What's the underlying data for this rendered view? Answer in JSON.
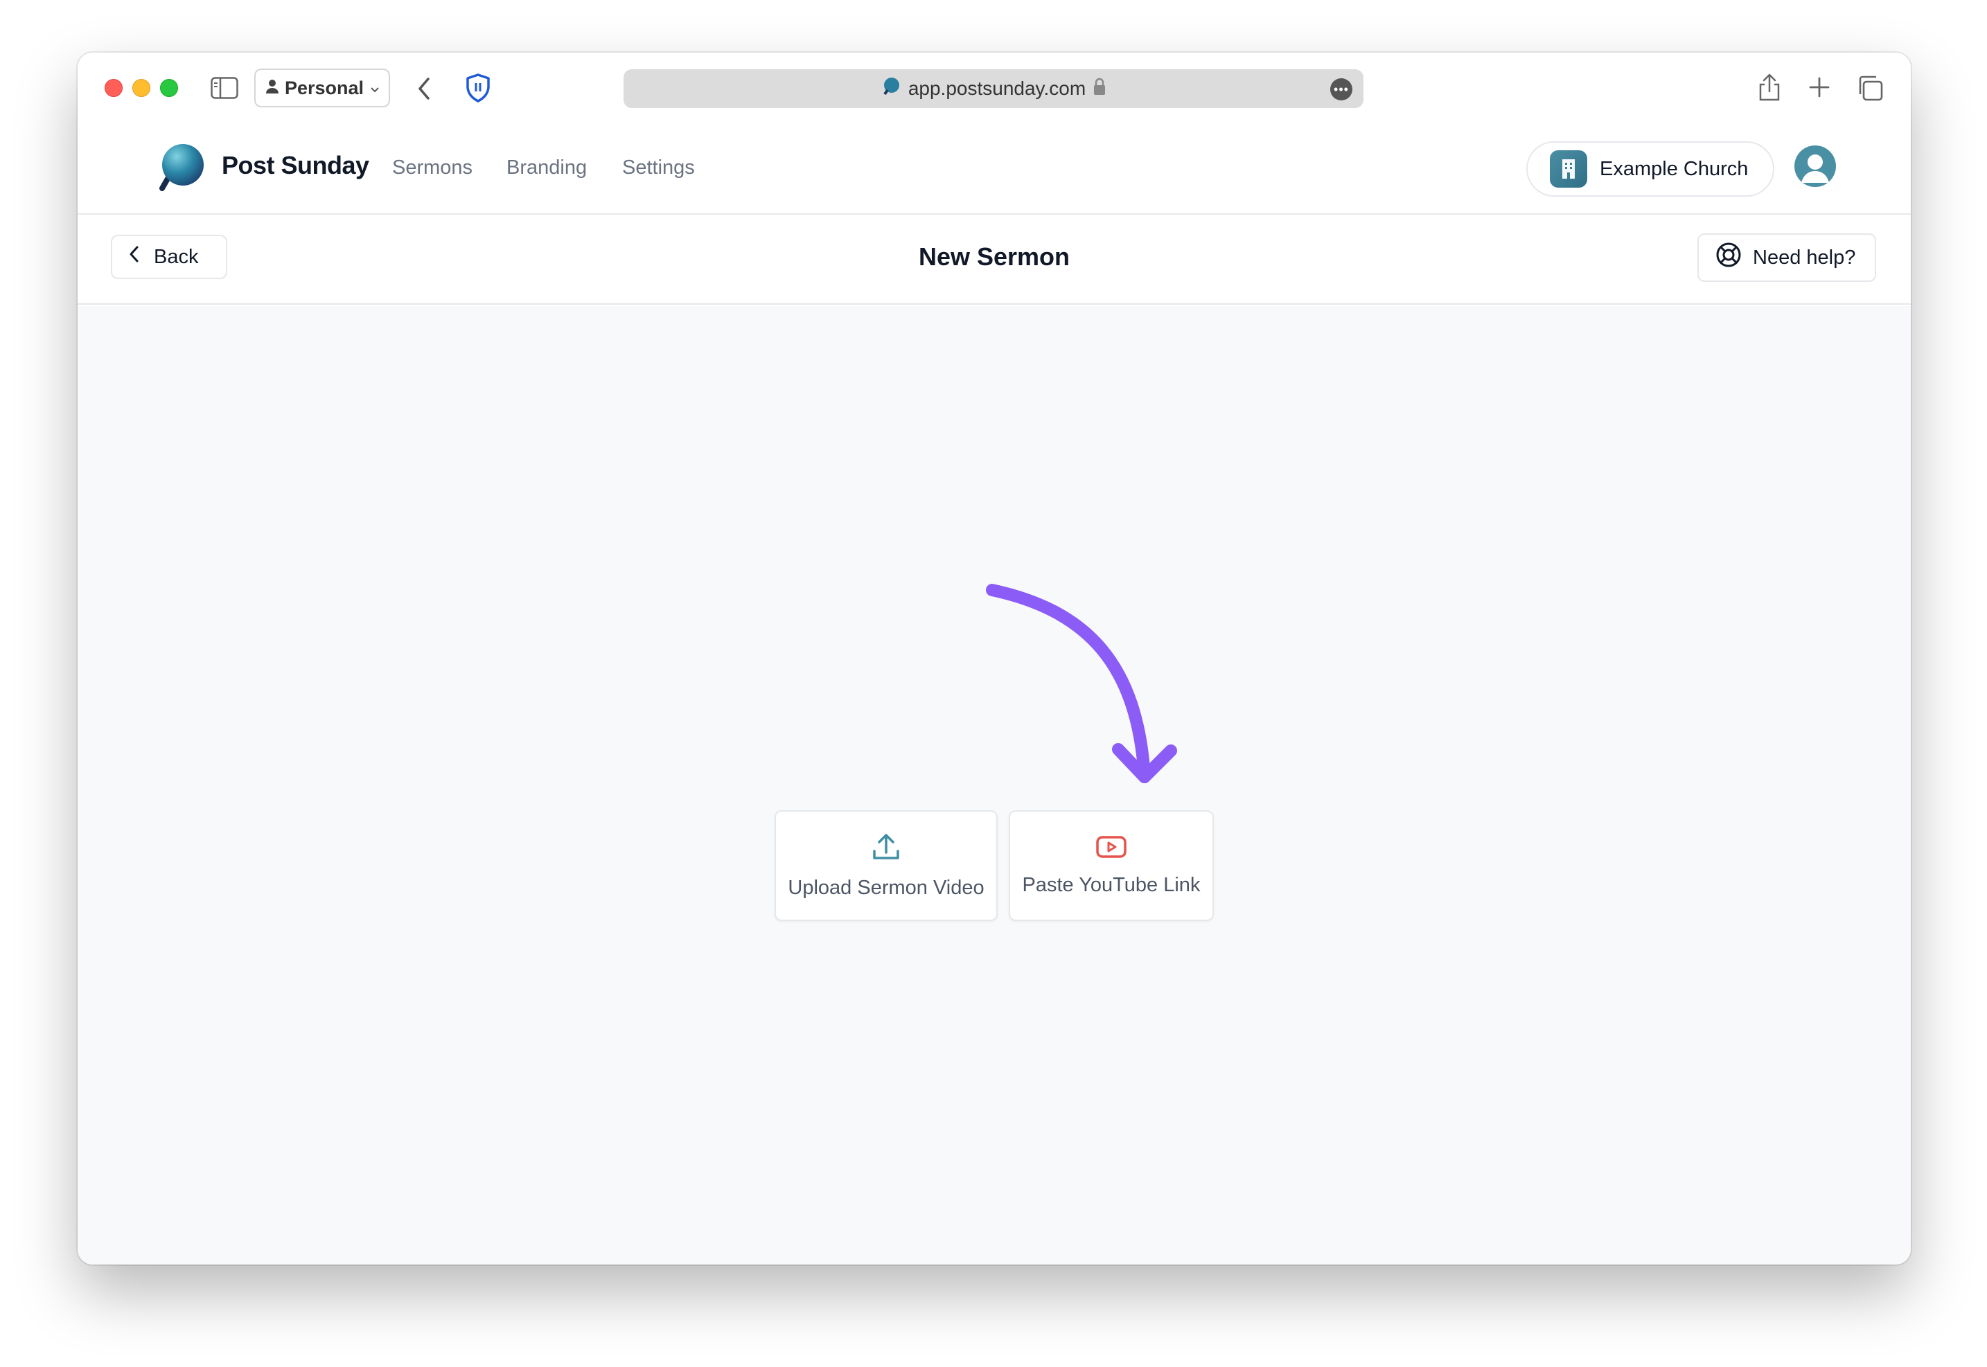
{
  "browser": {
    "profile_label": "Personal",
    "url": "app.postsunday.com"
  },
  "app": {
    "brand": "Post Sunday",
    "nav": [
      {
        "label": "Sermons"
      },
      {
        "label": "Branding"
      },
      {
        "label": "Settings"
      }
    ],
    "church_name": "Example Church"
  },
  "page": {
    "back_label": "Back",
    "title": "New Sermon",
    "help_label": "Need help?"
  },
  "options": {
    "upload_label": "Upload Sermon Video",
    "youtube_label": "Paste YouTube Link"
  },
  "colors": {
    "arrow": "#8b5cf6",
    "upload_icon": "#3f8ea3",
    "youtube_icon": "#e5534b",
    "brand_teal": "#4a90a4"
  },
  "icons": [
    "sidebar-icon",
    "person-icon",
    "chevron-down-icon",
    "chevron-left-icon",
    "shield-icon",
    "lock-icon",
    "more-icon",
    "share-icon",
    "plus-icon",
    "tabs-icon",
    "building-icon",
    "lifebuoy-icon",
    "upload-icon",
    "youtube-icon"
  ]
}
